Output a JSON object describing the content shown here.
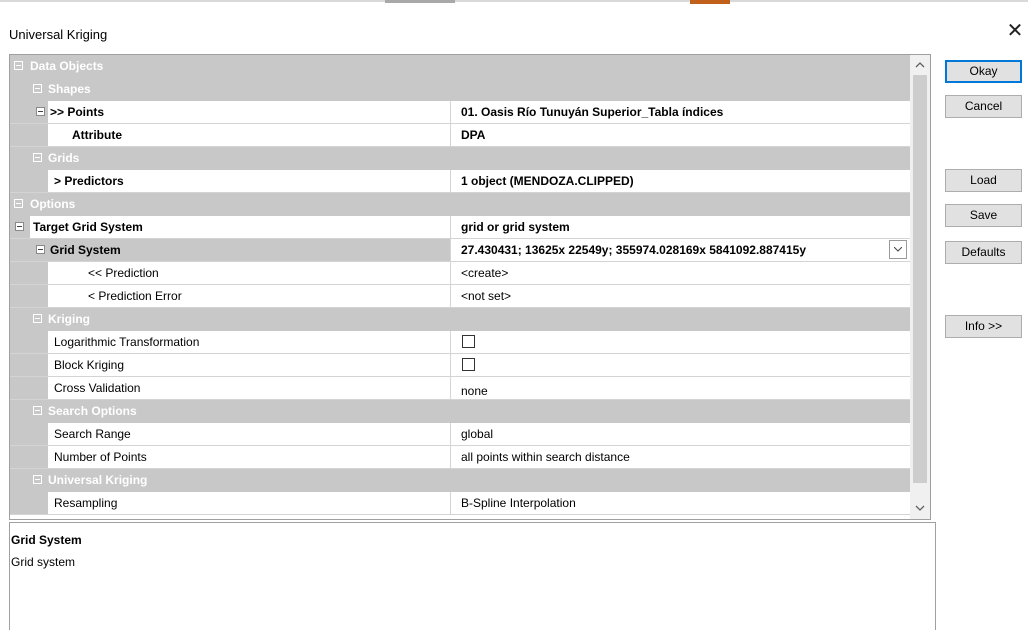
{
  "window": {
    "title": "Universal Kriging",
    "close_icon": "close-icon"
  },
  "buttons": {
    "okay": "Okay",
    "cancel": "Cancel",
    "load": "Load",
    "save": "Save",
    "defaults": "Defaults",
    "info": "Info >>"
  },
  "properties": {
    "data_objects": "Data Objects",
    "shapes": "Shapes",
    "points_label": ">> Points",
    "points_value": "01. Oasis Río Tunuyán Superior_Tabla índices",
    "attribute_label": "Attribute",
    "attribute_value": "DPA",
    "grids": "Grids",
    "predictors_label": "> Predictors",
    "predictors_value": "1 object (MENDOZA.CLIPPED)",
    "options": "Options",
    "target_grid_label": "Target Grid System",
    "target_grid_value": "grid or grid system",
    "grid_system_label": "Grid System",
    "grid_system_value": "27.430431; 13625x 22549y; 355974.028169x 5841092.887415y",
    "prediction_label": "<< Prediction",
    "prediction_value": "<create>",
    "prediction_error_label": "< Prediction Error",
    "prediction_error_value": "<not set>",
    "kriging": "Kriging",
    "log_transform_label": "Logarithmic Transformation",
    "log_transform_checked": false,
    "block_kriging_label": "Block Kriging",
    "block_kriging_checked": false,
    "cross_validation_label": "Cross Validation",
    "cross_validation_value": "none",
    "search_options": "Search Options",
    "search_range_label": "Search Range",
    "search_range_value": "global",
    "num_points_label": "Number of Points",
    "num_points_value": "all points within search distance",
    "universal_kriging": "Universal Kriging",
    "resampling_label": "Resampling",
    "resampling_value": "B-Spline Interpolation"
  },
  "description": {
    "title": "Grid System",
    "text": "Grid system"
  },
  "colors": {
    "category_bg": "#c8c8c8",
    "accent": "#0078d7"
  }
}
